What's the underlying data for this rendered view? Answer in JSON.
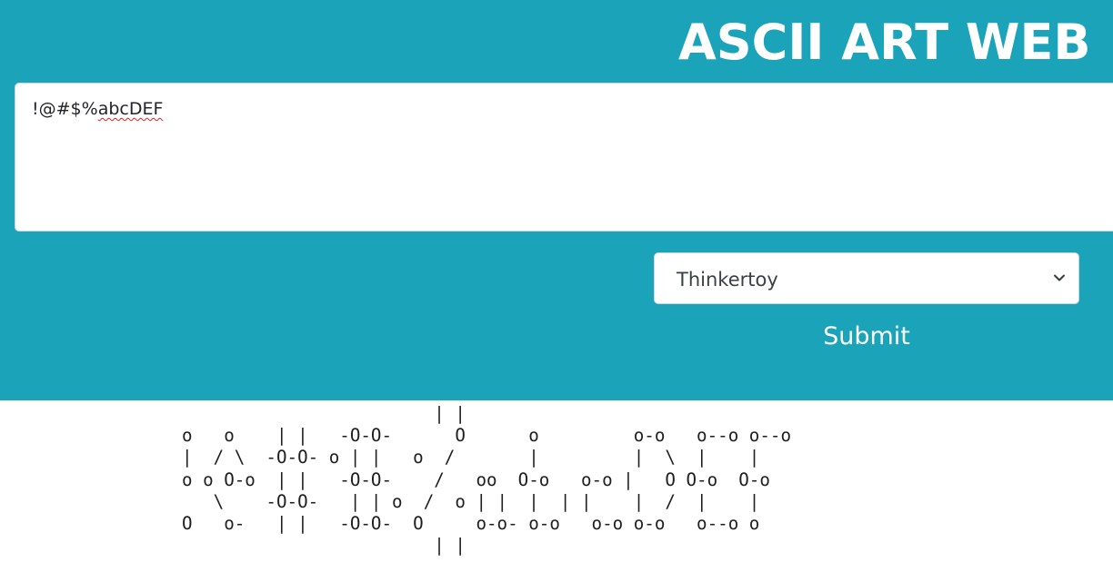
{
  "header": {
    "title": "ASCII ART WEB"
  },
  "form": {
    "input_prefix": "!@#$%",
    "input_misspelled": "abcDEF",
    "banner_selected": "Thinkertoy",
    "submit_label": "Submit"
  },
  "output": {
    "ascii_lines": [
      "                        | |",
      "o   o    | |   -O-O-      O      o         o-o   o--o o--o",
      "|  / \\  -O-O- o | |   o  /       |         |  \\  |    |",
      "o o O-o  | |   -O-O-    /   oo  O-o   o-o |   O O-o  O-o",
      "   \\    -O-O-   | | o  /  o | |  |  | |    |  /  |    |",
      "O   o-   | |   -O-O-  O     o-o- o-o   o-o o-o   o--o o",
      "                        | |"
    ]
  },
  "colors": {
    "panel_background": "#1aa3b9",
    "title_text": "#ffffff",
    "output_text": "#1e1e1e"
  },
  "icons": {
    "select_arrow": "chevron-down-icon"
  }
}
